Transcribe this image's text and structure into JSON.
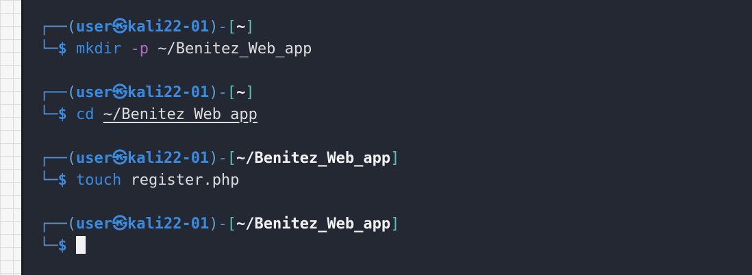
{
  "prompt": {
    "corner_top": "┌──",
    "corner_bottom": "└─",
    "open_paren": "(",
    "close_paren": ")",
    "user": "user",
    "at_symbol": "㉿",
    "host": "kali22-01",
    "dash": "-",
    "open_bracket": "[",
    "close_bracket": "]",
    "dollar": "$"
  },
  "entries": [
    {
      "cwd": "~",
      "command": "mkdir",
      "flag": "-p",
      "argument": "~/Benitez_Web_app"
    },
    {
      "cwd": "~",
      "command": "cd",
      "argument": "~/Benitez_Web_app"
    },
    {
      "cwd": "~/Benitez_Web_app",
      "command": "touch",
      "argument": "register.php"
    },
    {
      "cwd": "~/Benitez_Web_app",
      "command": ""
    }
  ],
  "colors": {
    "terminal_background": "#242833",
    "prompt_blue": "#3d8bdf",
    "bracket_teal": "#58c2b8",
    "flag_purple": "#b36ac5",
    "text": "#dddddd"
  }
}
